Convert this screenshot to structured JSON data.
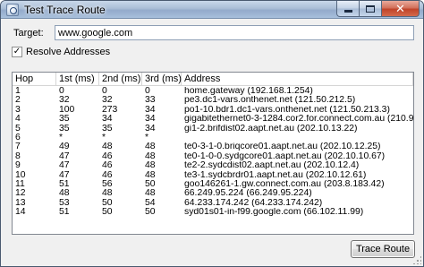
{
  "window": {
    "title": "Test Trace Route"
  },
  "target": {
    "label": "Target:",
    "value": "www.google.com"
  },
  "resolve": {
    "label": "Resolve Addresses",
    "checked": true,
    "check_glyph": "✓"
  },
  "table": {
    "columns": [
      "Hop",
      "1st (ms)",
      "2nd (ms)",
      "3rd (ms)",
      "Address"
    ],
    "rows": [
      [
        "1",
        "0",
        "0",
        "0",
        "home.gateway (192.168.1.254)"
      ],
      [
        "2",
        "32",
        "32",
        "33",
        "pe3.dc1-vars.onthenet.net (121.50.212.5)"
      ],
      [
        "3",
        "100",
        "273",
        "34",
        "po1-10.bdr1.dc1-vars.onthenet.net (121.50.213.3)"
      ],
      [
        "4",
        "35",
        "34",
        "34",
        "gigabitethernet0-3-1284.cor2.for.connect.com.au (210.9.87"
      ],
      [
        "5",
        "35",
        "35",
        "34",
        "gi1-2.brifdist02.aapt.net.au (202.10.13.22)"
      ],
      [
        "6",
        "*",
        "*",
        "*",
        ""
      ],
      [
        "7",
        "49",
        "48",
        "48",
        "te0-3-1-0.briqcore01.aapt.net.au (202.10.12.25)"
      ],
      [
        "8",
        "47",
        "46",
        "48",
        "te0-1-0-0.sydgcore01.aapt.net.au (202.10.10.67)"
      ],
      [
        "9",
        "47",
        "46",
        "48",
        "te2-2.sydcdist02.aapt.net.au (202.10.12.4)"
      ],
      [
        "10",
        "47",
        "46",
        "48",
        "te3-1.sydcbrdr01.aapt.net.au (202.10.12.61)"
      ],
      [
        "11",
        "51",
        "56",
        "50",
        "goo146261-1.gw.connect.com.au (203.8.183.42)"
      ],
      [
        "12",
        "48",
        "48",
        "48",
        "66.249.95.224 (66.249.95.224)"
      ],
      [
        "13",
        "53",
        "50",
        "54",
        "64.233.174.242 (64.233.174.242)"
      ],
      [
        "14",
        "51",
        "50",
        "50",
        "syd01s01-in-f99.google.com (66.102.11.99)"
      ]
    ]
  },
  "buttons": {
    "trace": "Trace Route",
    "close_glyph": "✕"
  }
}
